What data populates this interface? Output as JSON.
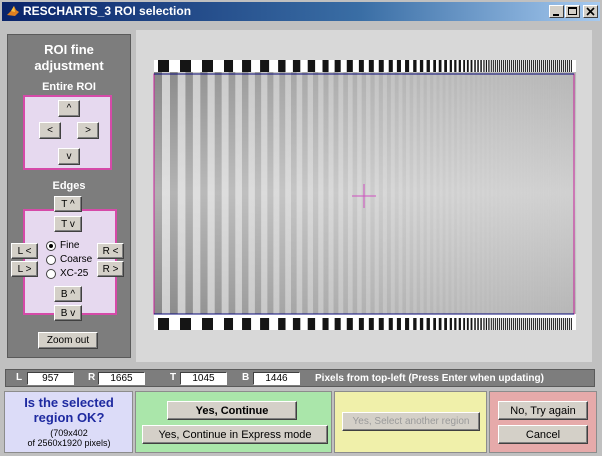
{
  "window": {
    "title": "RESCHARTS_3 ROI selection",
    "controls": {
      "minimize": "minimize-icon",
      "maximize": "maximize-icon",
      "close": "close-icon"
    }
  },
  "fine": {
    "title_line1": "ROI fine",
    "title_line2": "adjustment",
    "entire_roi_label": "Entire ROI",
    "up": "^",
    "left": "<",
    "right": ">",
    "down": "v",
    "edges_label": "Edges",
    "top_up": "T ^",
    "top_down": "T v",
    "left_left": "L <",
    "left_right": "L >",
    "right_left": "R <",
    "right_right": "R >",
    "bottom_up": "B ^",
    "bottom_down": "B v",
    "modes": [
      {
        "label": "Fine",
        "selected": true
      },
      {
        "label": "Coarse",
        "selected": false
      },
      {
        "label": "XC-25",
        "selected": false
      }
    ],
    "zoom_out": "Zoom out"
  },
  "coords": {
    "L_label": "L",
    "L": "957",
    "R_label": "R",
    "R": "1665",
    "T_label": "T",
    "T": "1045",
    "B_label": "B",
    "B": "1446",
    "hint": "Pixels from top-left  (Press Enter when updating)"
  },
  "bottom": {
    "question": "Is the selected region OK?",
    "size": "(709x402",
    "of": "of 2560x1920 pixels)",
    "yes_continue": "Yes, Continue",
    "yes_express": "Yes, Continue in Express mode",
    "yes_select_other": "Yes, Select another region",
    "no_try_again": "No, Try again",
    "cancel": "Cancel"
  },
  "colors": {
    "title_bar": "#0a246a",
    "panel_gray": "#7d7d7d",
    "roi_box": "#d54aa8",
    "bottom_lavender": "#dcdcf8",
    "bottom_green": "#aae6aa",
    "bottom_yellow": "#f0f0aa",
    "bottom_red": "#e6aaaa",
    "question_text": "#1e2aa0"
  }
}
